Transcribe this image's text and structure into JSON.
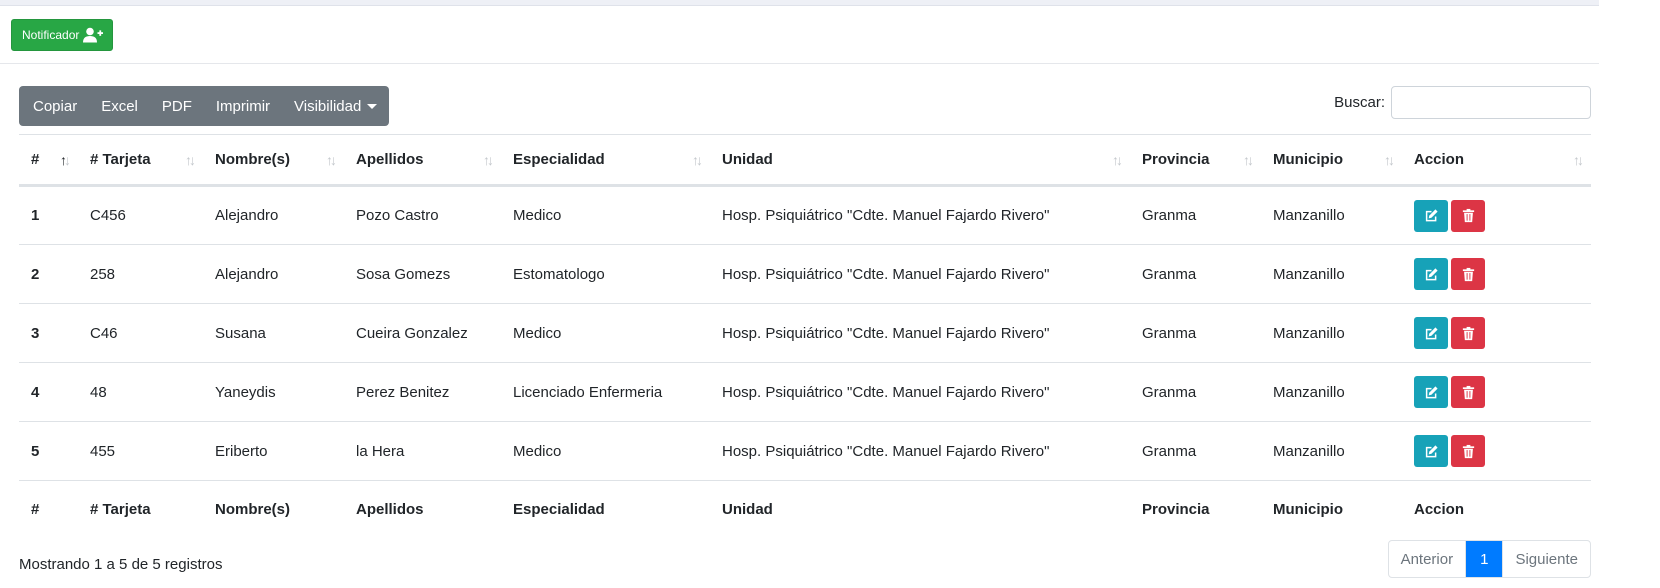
{
  "toolbar": {
    "notificador_label": "Notificador"
  },
  "buttons": {
    "copiar": "Copiar",
    "excel": "Excel",
    "pdf": "PDF",
    "imprimir": "Imprimir",
    "visibilidad": "Visibilidad"
  },
  "search": {
    "label": "Buscar:",
    "value": "",
    "placeholder": ""
  },
  "table": {
    "headers": [
      "#",
      "# Tarjeta",
      "Nombre(s)",
      "Apellidos",
      "Especialidad",
      "Unidad",
      "Provincia",
      "Municipio",
      "Accion"
    ],
    "rows": [
      [
        "1",
        "C456",
        "Alejandro",
        "Pozo Castro",
        "Medico",
        "Hosp. Psiquiátrico \"Cdte. Manuel Fajardo Rivero\"",
        "Granma",
        "Manzanillo"
      ],
      [
        "2",
        "258",
        "Alejandro",
        "Sosa Gomezs",
        "Estomatologo",
        "Hosp. Psiquiátrico \"Cdte. Manuel Fajardo Rivero\"",
        "Granma",
        "Manzanillo"
      ],
      [
        "3",
        "C46",
        "Susana",
        "Cueira Gonzalez",
        "Medico",
        "Hosp. Psiquiátrico \"Cdte. Manuel Fajardo Rivero\"",
        "Granma",
        "Manzanillo"
      ],
      [
        "4",
        "48",
        "Yaneydis",
        "Perez Benitez",
        "Licenciado Enfermeria",
        "Hosp. Psiquiátrico \"Cdte. Manuel Fajardo Rivero\"",
        "Granma",
        "Manzanillo"
      ],
      [
        "5",
        "455",
        "Eriberto",
        "la Hera",
        "Medico",
        "Hosp. Psiquiátrico \"Cdte. Manuel Fajardo Rivero\"",
        "Granma",
        "Manzanillo"
      ]
    ],
    "sorted_column": "#"
  },
  "info": "Mostrando 1 a 5 de 5 registros",
  "pagination": {
    "prev": "Anterior",
    "current": "1",
    "next": "Siguiente"
  },
  "colors": {
    "success": "#28a745",
    "secondary": "#6c757d",
    "info": "#17a2b8",
    "danger": "#dc3545",
    "primary": "#007bff"
  },
  "icons": {
    "notificador": "user-plus-icon",
    "edit": "edit-icon",
    "delete": "trash-icon",
    "sort": "sort-icon"
  }
}
